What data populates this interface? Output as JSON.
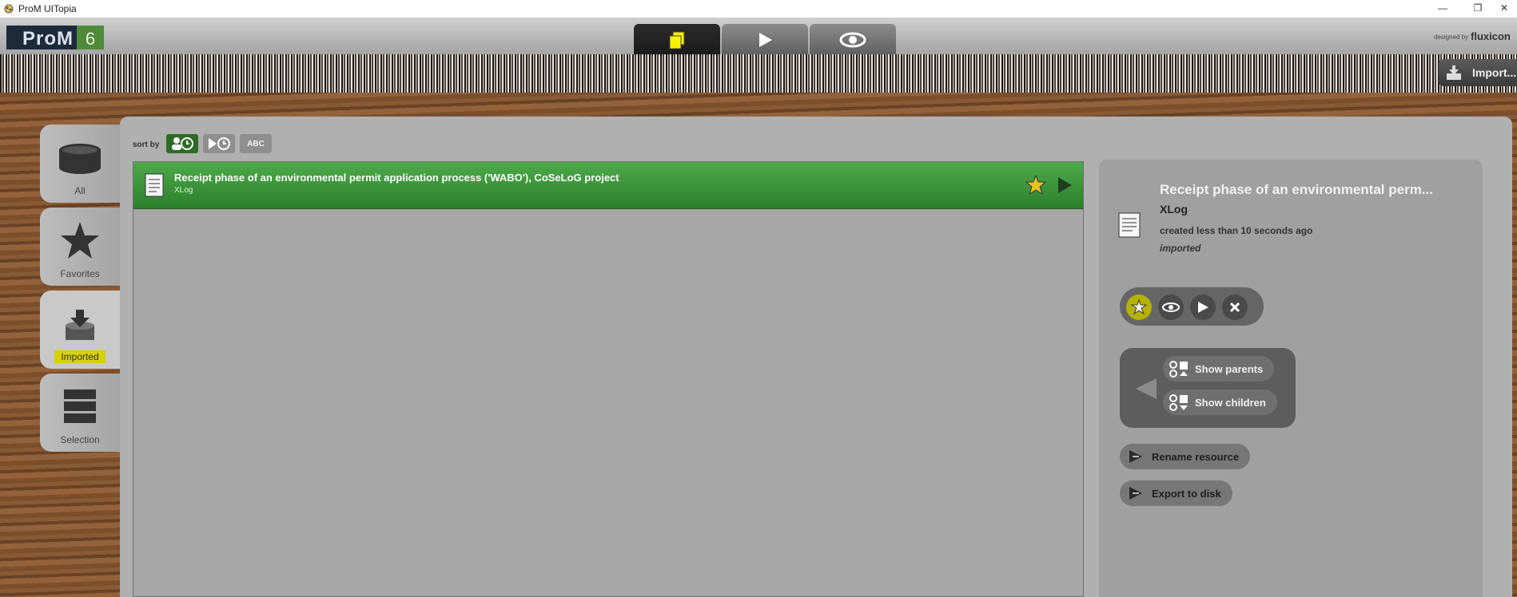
{
  "window": {
    "title": "ProM UITopia",
    "minimize": "—",
    "restore": "❐",
    "close": "✕"
  },
  "logo": {
    "name": "ProM",
    "version": "6"
  },
  "branding": {
    "designed_by": "designed by",
    "company": "fluxicon"
  },
  "toolbar": {
    "import_label": "Import...",
    "tabs": [
      "workspace-tab",
      "actions-tab",
      "views-tab"
    ]
  },
  "sidebar": {
    "items": [
      {
        "label": "All",
        "icon": "database-icon"
      },
      {
        "label": "Favorites",
        "icon": "star-icon"
      },
      {
        "label": "Imported",
        "icon": "imported-icon",
        "active": true
      },
      {
        "label": "Selection",
        "icon": "selection-icon"
      }
    ]
  },
  "sort": {
    "label": "sort by",
    "abc_label": "ABC"
  },
  "list": {
    "rows": [
      {
        "name": "Receipt phase of an environmental permit application process ('WABO'), CoSeLoG project",
        "type": "XLog"
      }
    ]
  },
  "details": {
    "title": "Receipt phase of an environmental perm...",
    "type": "XLog",
    "created": "created less than 10 seconds ago",
    "status": "imported",
    "show_parents": "Show parents",
    "show_children": "Show children",
    "rename": "Rename resource",
    "export": "Export to disk"
  },
  "colors": {
    "accent_green": "#3b963a",
    "highlight_yellow": "#d6d100",
    "panel_gray": "#b0b0b0"
  }
}
